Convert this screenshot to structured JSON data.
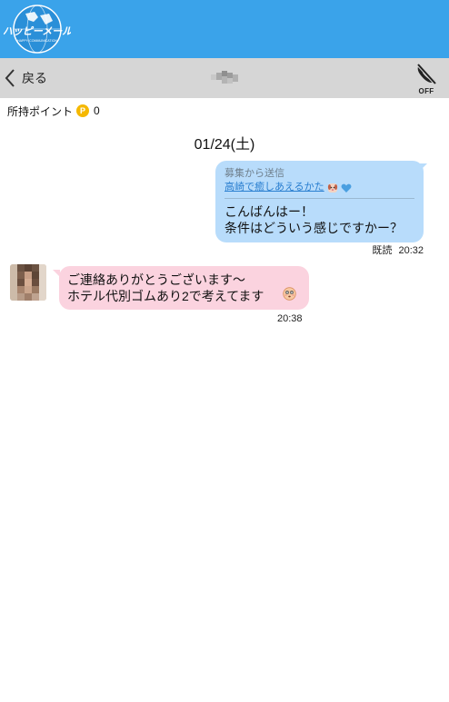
{
  "header": {
    "logo_text": "ハッピーメール",
    "logo_subtext": "HAPPY COMMUNICATION",
    "bg_color": "#3aa3ea"
  },
  "nav": {
    "back_label": "戻る",
    "back_icon": "chevron-left-icon",
    "call_icon": "phone-off-icon",
    "call_status": "OFF"
  },
  "points": {
    "label": "所持ポイント",
    "badge": "P",
    "value": "0"
  },
  "chat": {
    "date": "01/24(土)",
    "messages": [
      {
        "direction": "outgoing",
        "via_label": "募集から送信",
        "board_title": "高崎で癒しあえるかた",
        "text": "こんばんはー！\n条件はどういう感じですかー？",
        "read_label": "既読",
        "time": "20:32",
        "bubble_color": "#b8dcfb"
      },
      {
        "direction": "incoming",
        "text": "ご連絡ありがとうございます〜\nホテル代別ゴムあり2で考えてます",
        "time": "20:38",
        "bubble_color": "#fbd3df"
      }
    ]
  }
}
